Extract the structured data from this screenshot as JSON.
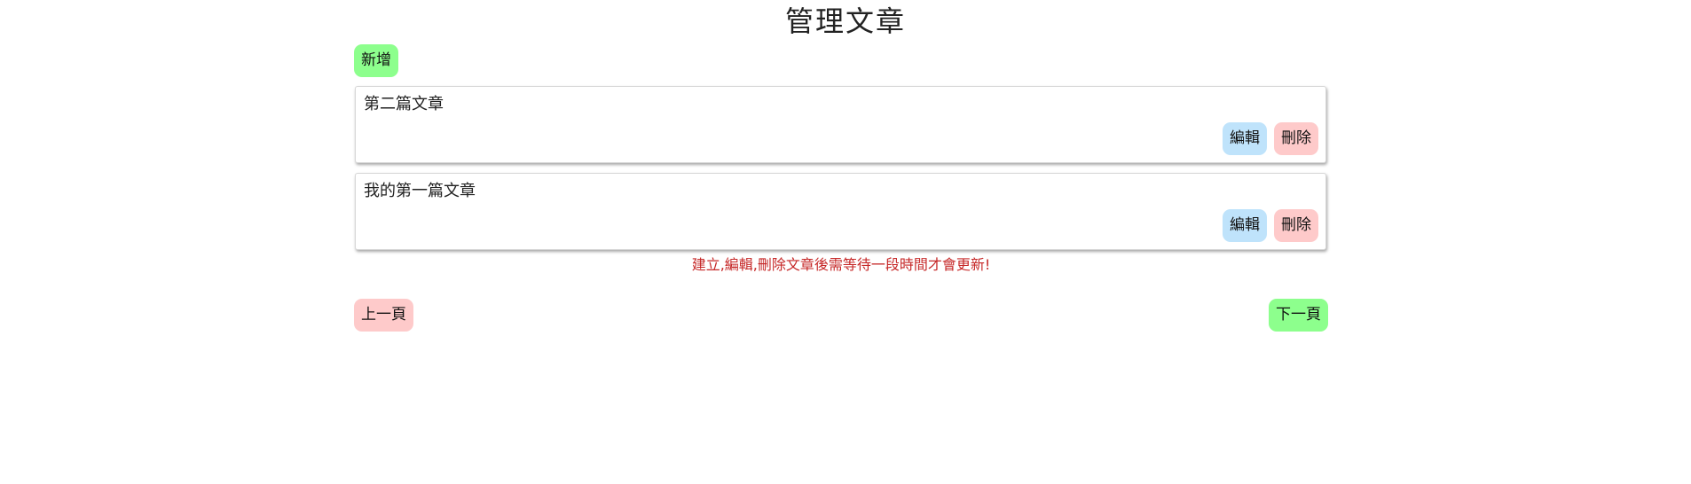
{
  "page": {
    "title": "管理文章"
  },
  "toolbar": {
    "add_label": "新增"
  },
  "articles": [
    {
      "title": "第二篇文章",
      "edit_label": "編輯",
      "delete_label": "刪除"
    },
    {
      "title": "我的第一篇文章",
      "edit_label": "編輯",
      "delete_label": "刪除"
    }
  ],
  "notice": "建立,編輯,刪除文章後需等待一段時間才會更新!",
  "pagination": {
    "prev_label": "上一頁",
    "next_label": "下一頁"
  },
  "colors": {
    "add_button": "#8dff8d",
    "edit_button": "#bfe3fb",
    "delete_button": "#fecaca",
    "prev_button": "#fecaca",
    "next_button": "#8dff8d",
    "notice_text": "#c62828"
  }
}
